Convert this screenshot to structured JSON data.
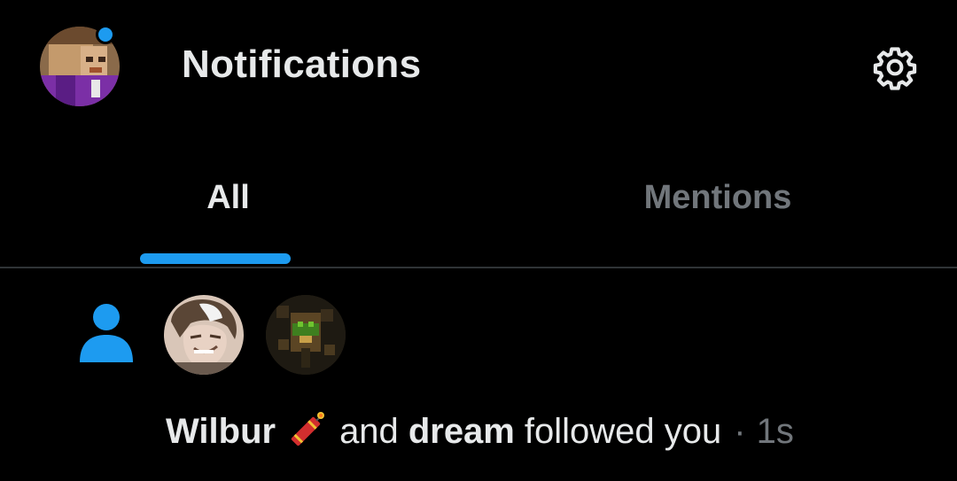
{
  "header": {
    "title": "Notifications",
    "profile_avatar": "profile-avatar",
    "has_unread_dot": true,
    "settings_icon": "gear-icon"
  },
  "tabs": [
    {
      "label": "All",
      "active": true
    },
    {
      "label": "Mentions",
      "active": false
    }
  ],
  "notification": {
    "icon": "person-icon",
    "avatars": [
      "wilbur-avatar",
      "dream-avatar"
    ],
    "user1": "Wilbur",
    "user1_emoji": "firecracker",
    "connector": "and",
    "user2": "dream",
    "action": "followed you",
    "separator": "·",
    "time": "1s"
  },
  "colors": {
    "background": "#000000",
    "accent": "#1d9bf0",
    "text": "#e7e9ea",
    "muted": "#71767b",
    "divider": "#2f3336"
  }
}
